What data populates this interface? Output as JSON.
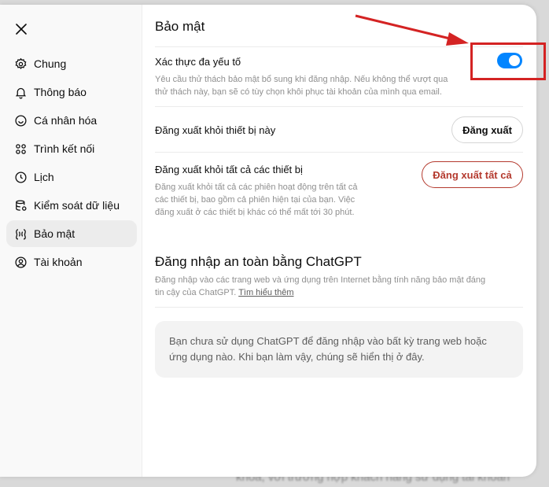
{
  "sidebar": {
    "items": [
      {
        "label": "Chung",
        "icon": "gear-icon"
      },
      {
        "label": "Thông báo",
        "icon": "bell-icon"
      },
      {
        "label": "Cá nhân hóa",
        "icon": "personalize-icon"
      },
      {
        "label": "Trình kết nối",
        "icon": "connectors-icon"
      },
      {
        "label": "Lịch",
        "icon": "clock-icon"
      },
      {
        "label": "Kiểm soát dữ liệu",
        "icon": "database-icon"
      },
      {
        "label": "Bảo mật",
        "icon": "shield-icon",
        "active": true
      },
      {
        "label": "Tài khoản",
        "icon": "user-icon"
      }
    ]
  },
  "main": {
    "title": "Bảo mật",
    "mfa": {
      "label": "Xác thực đa yếu tố",
      "desc_line1": "Yêu cầu thử thách bảo mật bổ sung khi đăng nhập. Nếu không thể vượt qua",
      "desc_line2": "thử thách này, bạn sẽ có tùy chọn khôi phục tài khoản của mình qua email.",
      "enabled": true
    },
    "logout": {
      "label": "Đăng xuất khỏi thiết bị này",
      "button": "Đăng xuất"
    },
    "logout_all": {
      "label": "Đăng xuất khỏi tất cả các thiết bị",
      "desc_line1": "Đăng xuất khỏi tất cả các phiên hoạt động trên tất cả",
      "desc_line2": "các thiết bị, bao gồm cả phiên hiện tại của bạn. Việc",
      "desc_line3": "đăng xuất ở các thiết bị khác có thể mất tới 30 phút.",
      "button": "Đăng xuất tất cả"
    },
    "secure_login": {
      "title": "Đăng nhập an toàn bằng ChatGPT",
      "desc_line1": "Đăng nhập vào các trang web và ứng dụng trên Internet bằng tính năng bảo mật đáng",
      "desc_line2_prefix": "tin cậy của ChatGPT. ",
      "learn_more": "Tìm hiểu thêm",
      "info_line1": "Bạn chưa sử dụng ChatGPT để đăng nhập vào bất kỳ trang web hoặc",
      "info_line2": "ứng dụng nào. Khi bạn làm vậy, chúng sẽ hiển thị ở đây."
    }
  },
  "background": {
    "bottom_text": "khóa, với trường hợp khách hàng sử dụng tài khoản"
  },
  "colors": {
    "toggle_on": "#0285ff",
    "danger": "#b43a2e",
    "annotation": "#d42323"
  }
}
